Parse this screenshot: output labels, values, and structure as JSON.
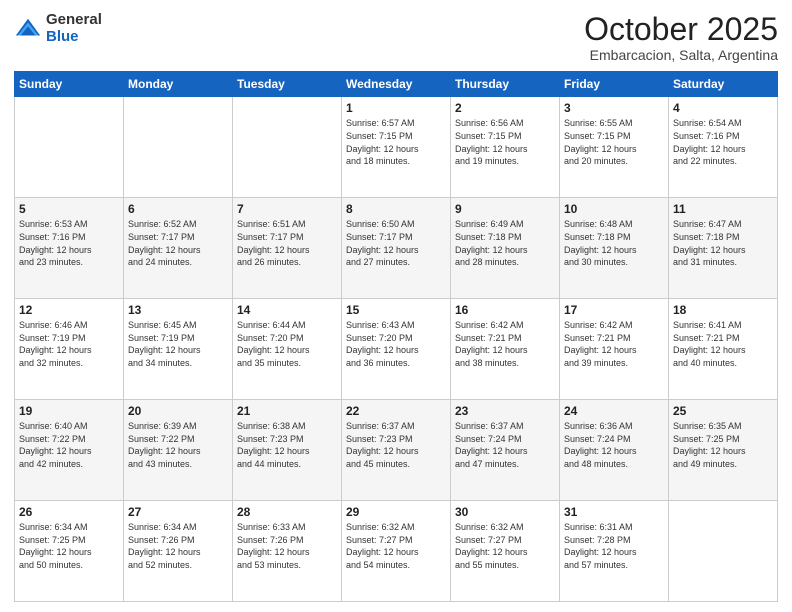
{
  "header": {
    "logo_general": "General",
    "logo_blue": "Blue",
    "month_title": "October 2025",
    "location": "Embarcacion, Salta, Argentina"
  },
  "days_of_week": [
    "Sunday",
    "Monday",
    "Tuesday",
    "Wednesday",
    "Thursday",
    "Friday",
    "Saturday"
  ],
  "weeks": [
    [
      {
        "day": "",
        "info": ""
      },
      {
        "day": "",
        "info": ""
      },
      {
        "day": "",
        "info": ""
      },
      {
        "day": "1",
        "info": "Sunrise: 6:57 AM\nSunset: 7:15 PM\nDaylight: 12 hours\nand 18 minutes."
      },
      {
        "day": "2",
        "info": "Sunrise: 6:56 AM\nSunset: 7:15 PM\nDaylight: 12 hours\nand 19 minutes."
      },
      {
        "day": "3",
        "info": "Sunrise: 6:55 AM\nSunset: 7:15 PM\nDaylight: 12 hours\nand 20 minutes."
      },
      {
        "day": "4",
        "info": "Sunrise: 6:54 AM\nSunset: 7:16 PM\nDaylight: 12 hours\nand 22 minutes."
      }
    ],
    [
      {
        "day": "5",
        "info": "Sunrise: 6:53 AM\nSunset: 7:16 PM\nDaylight: 12 hours\nand 23 minutes."
      },
      {
        "day": "6",
        "info": "Sunrise: 6:52 AM\nSunset: 7:17 PM\nDaylight: 12 hours\nand 24 minutes."
      },
      {
        "day": "7",
        "info": "Sunrise: 6:51 AM\nSunset: 7:17 PM\nDaylight: 12 hours\nand 26 minutes."
      },
      {
        "day": "8",
        "info": "Sunrise: 6:50 AM\nSunset: 7:17 PM\nDaylight: 12 hours\nand 27 minutes."
      },
      {
        "day": "9",
        "info": "Sunrise: 6:49 AM\nSunset: 7:18 PM\nDaylight: 12 hours\nand 28 minutes."
      },
      {
        "day": "10",
        "info": "Sunrise: 6:48 AM\nSunset: 7:18 PM\nDaylight: 12 hours\nand 30 minutes."
      },
      {
        "day": "11",
        "info": "Sunrise: 6:47 AM\nSunset: 7:18 PM\nDaylight: 12 hours\nand 31 minutes."
      }
    ],
    [
      {
        "day": "12",
        "info": "Sunrise: 6:46 AM\nSunset: 7:19 PM\nDaylight: 12 hours\nand 32 minutes."
      },
      {
        "day": "13",
        "info": "Sunrise: 6:45 AM\nSunset: 7:19 PM\nDaylight: 12 hours\nand 34 minutes."
      },
      {
        "day": "14",
        "info": "Sunrise: 6:44 AM\nSunset: 7:20 PM\nDaylight: 12 hours\nand 35 minutes."
      },
      {
        "day": "15",
        "info": "Sunrise: 6:43 AM\nSunset: 7:20 PM\nDaylight: 12 hours\nand 36 minutes."
      },
      {
        "day": "16",
        "info": "Sunrise: 6:42 AM\nSunset: 7:21 PM\nDaylight: 12 hours\nand 38 minutes."
      },
      {
        "day": "17",
        "info": "Sunrise: 6:42 AM\nSunset: 7:21 PM\nDaylight: 12 hours\nand 39 minutes."
      },
      {
        "day": "18",
        "info": "Sunrise: 6:41 AM\nSunset: 7:21 PM\nDaylight: 12 hours\nand 40 minutes."
      }
    ],
    [
      {
        "day": "19",
        "info": "Sunrise: 6:40 AM\nSunset: 7:22 PM\nDaylight: 12 hours\nand 42 minutes."
      },
      {
        "day": "20",
        "info": "Sunrise: 6:39 AM\nSunset: 7:22 PM\nDaylight: 12 hours\nand 43 minutes."
      },
      {
        "day": "21",
        "info": "Sunrise: 6:38 AM\nSunset: 7:23 PM\nDaylight: 12 hours\nand 44 minutes."
      },
      {
        "day": "22",
        "info": "Sunrise: 6:37 AM\nSunset: 7:23 PM\nDaylight: 12 hours\nand 45 minutes."
      },
      {
        "day": "23",
        "info": "Sunrise: 6:37 AM\nSunset: 7:24 PM\nDaylight: 12 hours\nand 47 minutes."
      },
      {
        "day": "24",
        "info": "Sunrise: 6:36 AM\nSunset: 7:24 PM\nDaylight: 12 hours\nand 48 minutes."
      },
      {
        "day": "25",
        "info": "Sunrise: 6:35 AM\nSunset: 7:25 PM\nDaylight: 12 hours\nand 49 minutes."
      }
    ],
    [
      {
        "day": "26",
        "info": "Sunrise: 6:34 AM\nSunset: 7:25 PM\nDaylight: 12 hours\nand 50 minutes."
      },
      {
        "day": "27",
        "info": "Sunrise: 6:34 AM\nSunset: 7:26 PM\nDaylight: 12 hours\nand 52 minutes."
      },
      {
        "day": "28",
        "info": "Sunrise: 6:33 AM\nSunset: 7:26 PM\nDaylight: 12 hours\nand 53 minutes."
      },
      {
        "day": "29",
        "info": "Sunrise: 6:32 AM\nSunset: 7:27 PM\nDaylight: 12 hours\nand 54 minutes."
      },
      {
        "day": "30",
        "info": "Sunrise: 6:32 AM\nSunset: 7:27 PM\nDaylight: 12 hours\nand 55 minutes."
      },
      {
        "day": "31",
        "info": "Sunrise: 6:31 AM\nSunset: 7:28 PM\nDaylight: 12 hours\nand 57 minutes."
      },
      {
        "day": "",
        "info": ""
      }
    ]
  ]
}
